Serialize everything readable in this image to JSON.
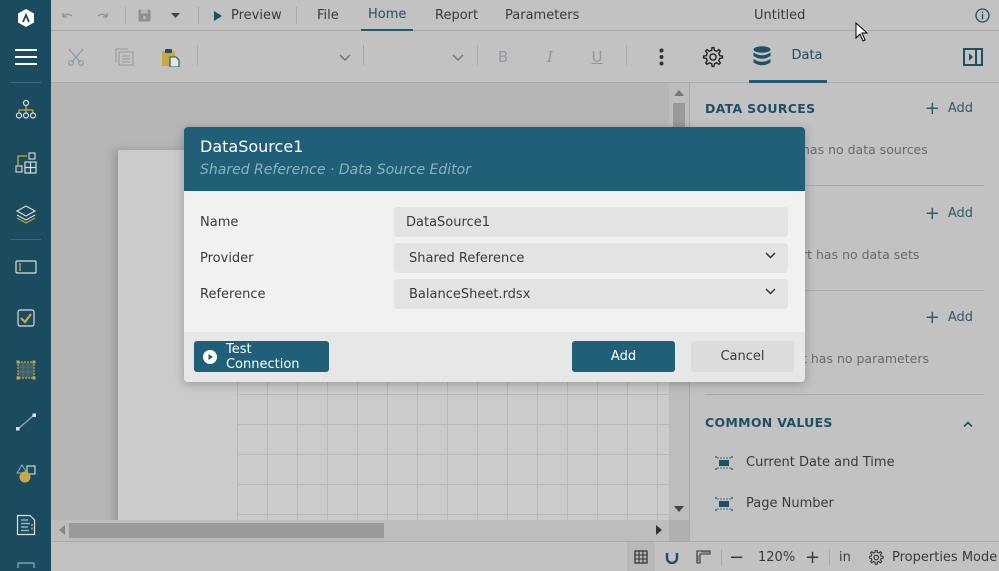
{
  "app": {
    "document_title": "Untitled"
  },
  "menubar": {
    "undo_icon": "undo-icon",
    "redo_icon": "redo-icon",
    "save_icon": "save-icon",
    "preview_label": "Preview",
    "tabs": [
      {
        "label": "File",
        "active": false
      },
      {
        "label": "Home",
        "active": true
      },
      {
        "label": "Report",
        "active": false
      },
      {
        "label": "Parameters",
        "active": false
      }
    ]
  },
  "toolbar": {
    "font_family_value": "",
    "font_size_value": "",
    "bold_label": "B",
    "italic_label": "I",
    "underline_label": "U",
    "data_tab_label": "Data"
  },
  "sidebar": {
    "items": [
      {
        "icon": "menu-icon"
      },
      {
        "icon": "report-explorer-icon"
      },
      {
        "icon": "group-editor-icon"
      },
      {
        "icon": "layers-icon"
      },
      {
        "icon": "textbox-icon"
      },
      {
        "icon": "checkbox-icon"
      },
      {
        "icon": "container-icon"
      },
      {
        "icon": "line-icon"
      },
      {
        "icon": "shape-icon"
      },
      {
        "icon": "formatted-text-icon"
      }
    ]
  },
  "right_panel": {
    "data_sources": {
      "heading": "DATA SOURCES",
      "add_label": "Add",
      "empty_text": "has no data sources"
    },
    "data_sets": {
      "add_label": "Add",
      "empty_text": "rt has no data sets"
    },
    "parameters": {
      "add_label": "Add",
      "empty_text": "t has no parameters"
    },
    "common_values": {
      "heading": "COMMON VALUES",
      "items": [
        "Current Date and Time",
        "Page Number"
      ]
    }
  },
  "statusbar": {
    "zoom_value": "120%",
    "units": "in",
    "properties_mode_label": "Properties Mode"
  },
  "dialog": {
    "title": "DataSource1",
    "subtitle": "Shared Reference · Data Source Editor",
    "fields": {
      "name_label": "Name",
      "name_value": "DataSource1",
      "provider_label": "Provider",
      "provider_value": "Shared Reference",
      "reference_label": "Reference",
      "reference_value": "BalanceSheet.rdsx"
    },
    "test_connection_label": "Test Connection",
    "add_label": "Add",
    "cancel_label": "Cancel"
  },
  "colors": {
    "brand": "#1b4b5e",
    "dialog_header": "#1f5f77",
    "accent_gold": "#c9a944"
  }
}
